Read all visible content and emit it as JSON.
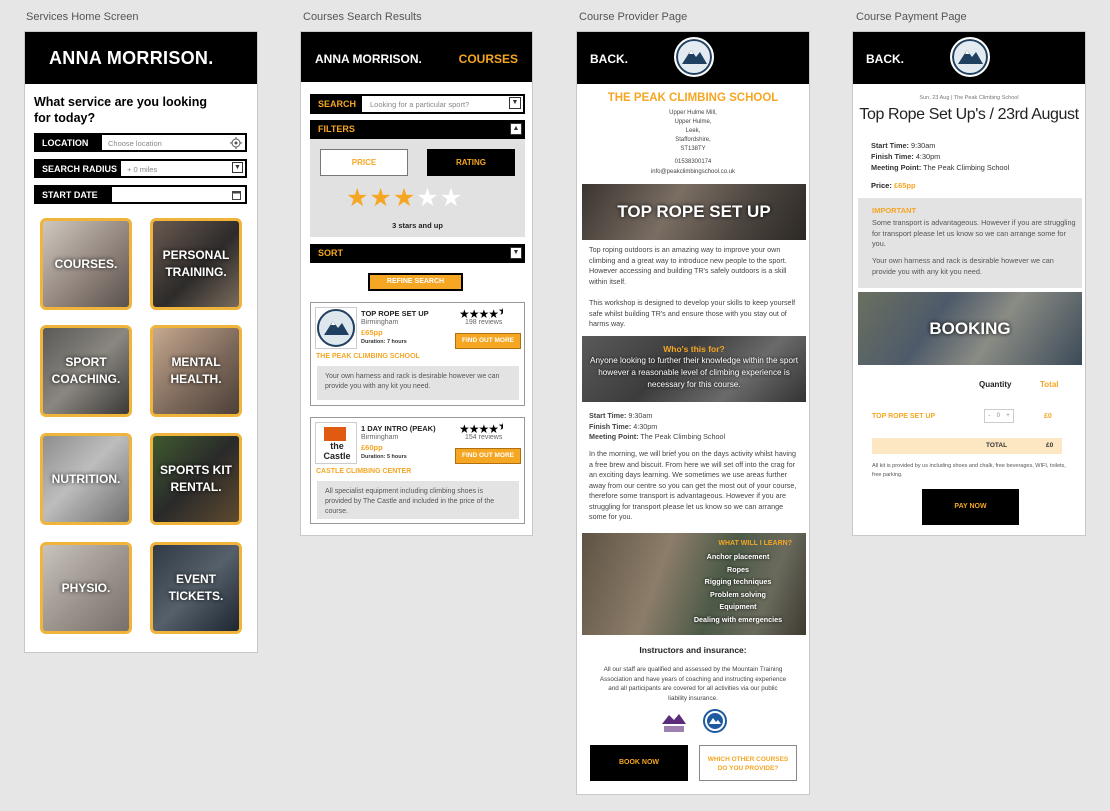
{
  "captions": [
    "Services Home Screen",
    "Courses Search Results",
    "Course Provider Page",
    "Course Payment Page"
  ],
  "s1": {
    "brand": "ANNA MORRISON.",
    "question": "What service are you looking for today?",
    "location": {
      "label": "LOCATION",
      "placeholder": "Choose location"
    },
    "radius": {
      "label": "SEARCH RADIUS",
      "value": "+ 0 miles"
    },
    "start": {
      "label": "START DATE"
    },
    "tiles": [
      "COURSES.",
      "PERSONAL TRAINING.",
      "SPORT COACHING.",
      "MENTAL HEALTH.",
      "NUTRITION.",
      "SPORTS KIT RENTAL.",
      "PHYSIO.",
      "EVENT TICKETS."
    ]
  },
  "s2": {
    "brand": "ANNA MORRISON.",
    "nav": "COURSES",
    "search_label": "SEARCH",
    "search_placeholder": "Looking for a particular sport?",
    "filters": "FILTERS",
    "price": "PRICE",
    "rating": "RATING",
    "rating_value": 3,
    "rating_text": "3 stars and up",
    "sort": "SORT",
    "refine": "REFINE SEARCH",
    "results": [
      {
        "title": "TOP ROPE SET UP",
        "city": "Birmingham",
        "price": "£65pp",
        "duration": "Duration: 7 hours",
        "reviews": "198 reviews",
        "stars": 4.5,
        "button": "FIND OUT MORE",
        "provider": "THE PEAK CLIMBING SCHOOL",
        "note": "Your own harness and rack is desirable however we can provide you with any kit you need."
      },
      {
        "title": "1 DAY INTRO (PEAK)",
        "city": "Birmingham",
        "price": "£60pp",
        "duration": "Duration: 5 hours",
        "reviews": "154 reviews",
        "stars": 4.5,
        "button": "FIND OUT MORE",
        "provider": "CASTLE CLIMBING CENTER",
        "note": "All specialist equipment including climbing shoes is provided by The Castle and included in the price of the course.",
        "logo_text": "the Castle"
      }
    ]
  },
  "s3": {
    "back": "BACK.",
    "school": "THE PEAK CLIMBING SCHOOL",
    "address": [
      "Upper Hulme Mill,",
      "Upper Hulme,",
      "Leek,",
      "Staffordshire,",
      "ST138TY"
    ],
    "phone": "01538300174",
    "email": "info@peakclimbingschool.co.uk",
    "banner": "TOP ROPE SET UP",
    "para1": "Top roping outdoors is an amazing way to improve your own climbing and a great way to introduce new people to the sport. However accessing and building TR's safely outdoors is a skill within itself.",
    "para2": "This workshop is designed to develop your skills to keep yourself safe whilst building TR's and ensure those with you stay out of harms way.",
    "who_title": "Who's this for?",
    "who_text": "Anyone looking to further their knowledge within the sport however a reasonable level of climbing experience is necessary for this course.",
    "start_label": "Start Time:",
    "start": "9:30am",
    "finish_label": "Finish Time:",
    "finish": "4:30pm",
    "meet_label": "Meeting Point:",
    "meet": "The Peak Climbing School",
    "para3": "In the morning, we will brief you on the days activity whilst having a free brew and biscuit. From here we will set off into the crag for an exciting days learning. We sometimes we use areas further away from our centre so you can get the most out of your course, therefore some transport is advantageous. However if you are struggling for transport please let us know so we can arrange some for you.",
    "learn_title": "WHAT WILL I LEARN?",
    "learn": [
      "Anchor placement",
      "Ropes",
      "Rigging techniques",
      "Problem solving",
      "Equipment",
      "Dealing with emergencies"
    ],
    "instr_title": "Instructors and insurance:",
    "instr_text": "All our staff are qualified and assessed by the Mountain Training Association and have years of coaching and instructing experience and all participants are covered for all activities via our public liability insurance.",
    "book": "BOOK NOW",
    "other": "WHICH OTHER COURSES DO YOU PROVIDE?"
  },
  "s4": {
    "back": "BACK.",
    "crumb": "Sun, 23 Aug  |  The Peak Climbing School",
    "title": "Top Rope Set Up's / 23rd August",
    "start_label": "Start Time:",
    "start": "9:30am",
    "finish_label": "Finish Time:",
    "finish": "4:30pm",
    "meet_label": "Meeting Point:",
    "meet": "The Peak Climbing School",
    "price_label": "Price:",
    "price": "£65pp",
    "important_title": "IMPORTANT",
    "important1": "Some transport is advantageous.  However if you are struggling for transport please let us know so we can arrange some for you.",
    "important2": "Your own harness and rack is desirable however we can provide you with any kit you need.",
    "booking": "BOOKING",
    "qty_label": "Quantity",
    "total_label": "Total",
    "item": "TOP ROPE SET UP",
    "qty": "0",
    "item_total": "£0",
    "grand_label": "TOTAL",
    "grand": "£0",
    "fine": "All kit is provided by us including shoes and chalk, free beverages, WIFI, toilets, free parking.",
    "pay": "PAY NOW"
  }
}
